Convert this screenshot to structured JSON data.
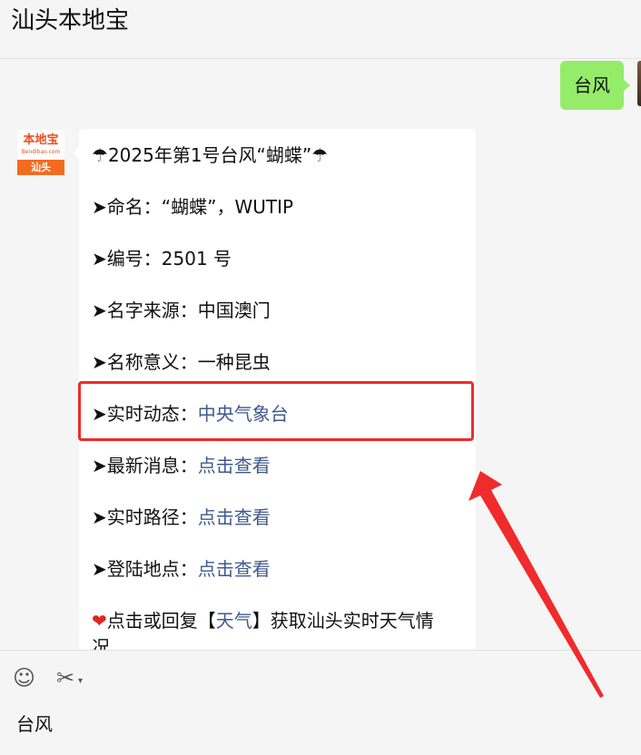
{
  "header": {
    "title": "汕头本地宝"
  },
  "sent_message": {
    "text": "台风"
  },
  "sender_avatar": {
    "brand": "本地宝",
    "brand_sub": "Bendibao.com",
    "city": "汕头"
  },
  "reply": {
    "title_text": "2025年第1号台风“蝴蝶”",
    "items": [
      {
        "label": "➤命名：",
        "value": "“蝴蝶”，WUTIP"
      },
      {
        "label": "➤编号：",
        "value": "2501 号"
      },
      {
        "label": "➤名字来源：",
        "value": "中国澳门"
      },
      {
        "label": "➤名称意义：",
        "value": "一种昆虫"
      },
      {
        "label": "➤实时动态：",
        "value": "中央气象台"
      },
      {
        "label": "➤最新消息：",
        "value": "点击查看"
      },
      {
        "label": "➤实时路径：",
        "value": "点击查看"
      },
      {
        "label": "➤登陆地点：",
        "value": "点击查看"
      }
    ],
    "footer_prefix": "点击或回复【",
    "footer_link": "天气",
    "footer_suffix": "】获取汕头实时天气情",
    "footer_wrap": "况"
  },
  "input": {
    "text": "台风"
  },
  "icons": [
    "emoji-icon",
    "scissors-icon",
    "umbrella-icon",
    "heart-icon"
  ],
  "colors": {
    "bubble_out": "#95ec69",
    "link": "#3e5a8c",
    "highlight": "#f02b2b"
  }
}
